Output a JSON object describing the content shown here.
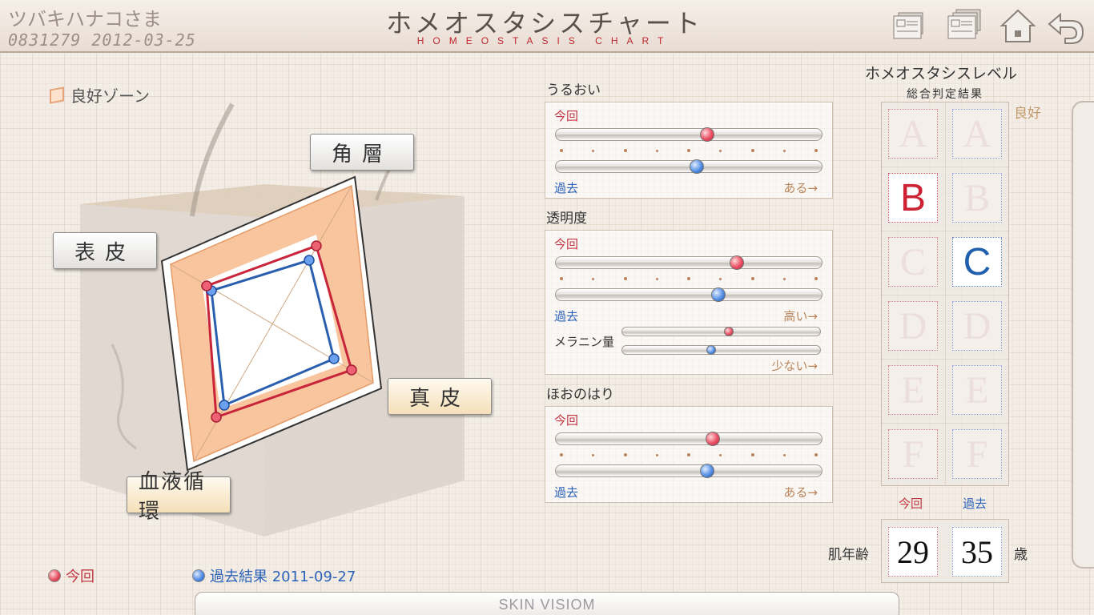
{
  "header": {
    "user_name": "ツバキハナコさま",
    "user_id_date": "0831279 2012-03-25",
    "title_ja": "ホメオスタシスチャート",
    "title_en": "HOMEOSTASIS CHART",
    "buttons": [
      "print-one-icon",
      "print-many-icon",
      "home-icon",
      "back-icon"
    ]
  },
  "radar": {
    "zone_legend": "良好ゾーン",
    "axes": {
      "top": "角層",
      "left": "表皮",
      "right": "真皮",
      "bottom": "血液循環"
    },
    "legend_now": "今回",
    "legend_past": "過去結果 2011-09-27",
    "colors": {
      "now": "#c8243a",
      "past": "#2a5faf",
      "zone": "#f9c59e"
    }
  },
  "sliders": {
    "now_label": "今回",
    "past_label": "過去",
    "items": [
      {
        "title": "うるおい",
        "end_label": "ある→",
        "now": 0.57,
        "past": 0.53
      },
      {
        "title": "透明度",
        "end_label": "高い→",
        "now": 0.68,
        "past": 0.61
      },
      {
        "title": "ほおのはり",
        "end_label": "ある→",
        "now": 0.59,
        "past": 0.57
      }
    ],
    "melanin": {
      "label": "メラニン量",
      "end_label": "少ない→",
      "now": 0.54,
      "past": 0.45
    }
  },
  "level": {
    "title": "ホメオスタシスレベル",
    "subtitle": "総合判定結果",
    "good_label": "良好",
    "grades": [
      "A",
      "B",
      "C",
      "D",
      "E",
      "F"
    ],
    "now_grade": "B",
    "past_grade": "C",
    "col_now": "今回",
    "col_past": "過去",
    "age_label": "肌年齢",
    "age_now": "29",
    "age_past": "35",
    "age_suffix": "歳"
  },
  "footer": {
    "logo": "SKIN VISIOM"
  }
}
